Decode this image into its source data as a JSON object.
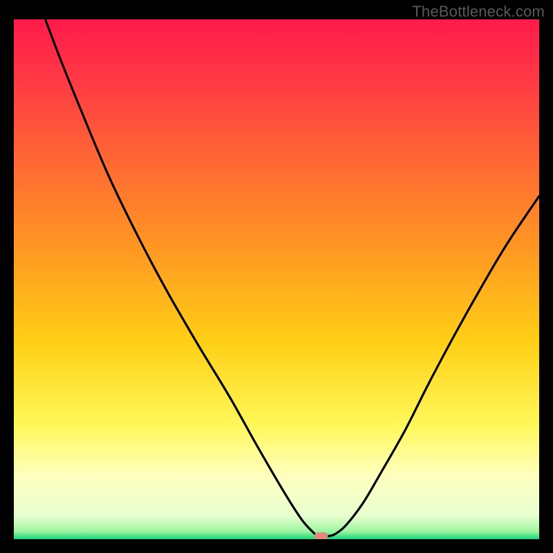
{
  "watermark": "TheBottleneck.com",
  "chart_data": {
    "type": "line",
    "title": "",
    "xlabel": "",
    "ylabel": "",
    "xlim": [
      0,
      100
    ],
    "ylim": [
      0,
      100
    ],
    "grid": false,
    "legend": false,
    "background_gradient": {
      "stops": [
        {
          "pos": 0.0,
          "color": "#ff1a4b"
        },
        {
          "pos": 0.12,
          "color": "#ff3a44"
        },
        {
          "pos": 0.28,
          "color": "#ff6a33"
        },
        {
          "pos": 0.45,
          "color": "#ff9a22"
        },
        {
          "pos": 0.62,
          "color": "#ffcf15"
        },
        {
          "pos": 0.78,
          "color": "#fff85a"
        },
        {
          "pos": 0.88,
          "color": "#ffffc0"
        },
        {
          "pos": 0.955,
          "color": "#e8ffd0"
        },
        {
          "pos": 0.985,
          "color": "#9cf5a0"
        },
        {
          "pos": 1.0,
          "color": "#18d67a"
        }
      ]
    },
    "series": [
      {
        "name": "curve",
        "x": [
          6.0,
          9.0,
          13.0,
          18.0,
          23.5,
          29.0,
          35.0,
          41.0,
          46.0,
          50.0,
          53.0,
          55.0,
          56.5,
          58.0,
          60.0,
          61.5,
          63.5,
          66.5,
          70.0,
          74.5,
          79.0,
          84.0,
          89.0,
          94.0,
          100.0
        ],
        "y": [
          100.0,
          92.0,
          82.0,
          70.0,
          58.5,
          48.0,
          37.5,
          27.5,
          18.5,
          11.5,
          6.5,
          3.5,
          1.8,
          0.6,
          0.6,
          1.2,
          3.0,
          7.0,
          13.0,
          21.0,
          30.0,
          39.5,
          48.5,
          57.0,
          66.0
        ]
      }
    ],
    "marker": {
      "x": 58.5,
      "y": 0.6,
      "color": "#e08a7a",
      "shape": "rounded-rect",
      "w": 2.6,
      "h": 1.4
    }
  }
}
